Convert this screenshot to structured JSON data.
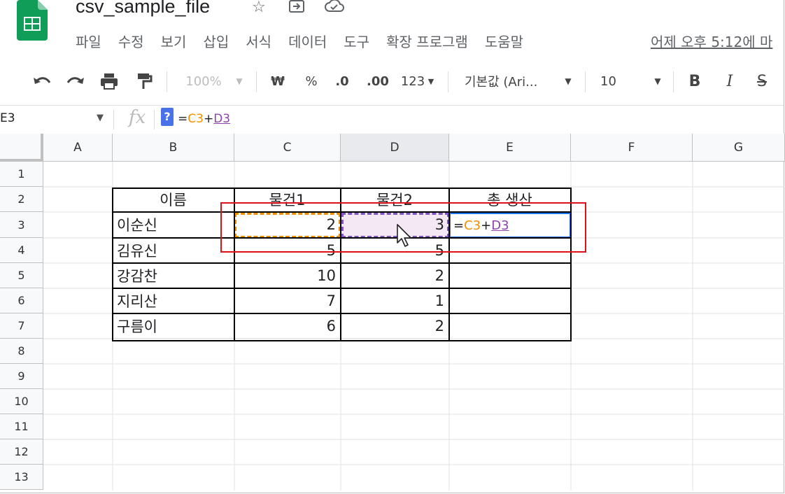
{
  "doc": {
    "title": "csv_sample_file",
    "menus": [
      "파일",
      "수정",
      "보기",
      "삽입",
      "서식",
      "데이터",
      "도구",
      "확장 프로그램",
      "도움말"
    ],
    "last_edit": "어제 오후 5:12에 마"
  },
  "toolbar": {
    "zoom": "100%",
    "currency": "₩",
    "percent": "%",
    "dec_less": ".0",
    "dec_more": ".00",
    "format_more": "123",
    "font": "기본값 (Ari...",
    "font_size": "10",
    "bold": "B",
    "italic": "I",
    "strike": "S"
  },
  "formula_bar": {
    "name_box": "E3",
    "fx": "fx",
    "help": "?",
    "eq": "=",
    "ref1": "C3",
    "plus": "+",
    "ref2": "D3"
  },
  "sheet": {
    "columns": [
      "A",
      "B",
      "C",
      "D",
      "E",
      "F",
      "G"
    ],
    "rows": [
      "1",
      "2",
      "3",
      "4",
      "5",
      "6",
      "7",
      "8",
      "9",
      "10",
      "11",
      "12",
      "13"
    ],
    "headers": [
      "이름",
      "물건1",
      "물건2",
      "총 생산"
    ],
    "data": [
      {
        "name": "이순신",
        "a": "2",
        "b": "3"
      },
      {
        "name": "김유신",
        "a": "5",
        "b": "5"
      },
      {
        "name": "강감찬",
        "a": "10",
        "b": "2"
      },
      {
        "name": "지리산",
        "a": "7",
        "b": "1"
      },
      {
        "name": "구름이",
        "a": "6",
        "b": "2"
      }
    ],
    "active_cell": {
      "eq": "=",
      "ref1": "C3",
      "plus": "+",
      "ref2": "D3"
    }
  },
  "colors": {
    "accent": "#1a73e8",
    "orange_ref": "#f09000",
    "purple_ref": "#7e57c2",
    "highlight": "#e0101a",
    "sheets_green": "#0f9d58"
  }
}
